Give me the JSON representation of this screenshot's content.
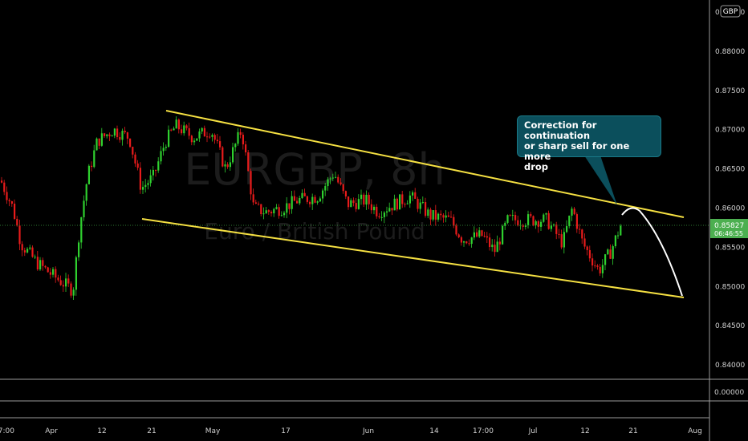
{
  "chart_data": {
    "type": "candlestick",
    "symbol_watermark": "EURGBP, 8h",
    "description_watermark": "Euro / British Pound",
    "currency_badge": "GBP",
    "x_tick_labels": [
      "17:00",
      "Apr",
      "12",
      "21",
      "May",
      "17",
      "Jun",
      "14",
      "17:00",
      "Jul",
      "12",
      "21",
      "Aug"
    ],
    "y_tick_labels": [
      "0.88500",
      "0.88000",
      "0.87500",
      "0.87000",
      "0.86500",
      "0.86000",
      "0.85500",
      "0.85000",
      "0.84500",
      "0.84000"
    ],
    "ylim": [
      0.837,
      0.8885
    ],
    "last_price": "0.85827",
    "countdown": "06:46:55",
    "indicator_tick_label": "0.00000",
    "trendlines": [
      {
        "name": "upper channel",
        "from": {
          "x": "Apr 21",
          "y": 0.8727
        },
        "to": {
          "x": "Jul 27",
          "y": 0.8589
        }
      },
      {
        "name": "lower channel",
        "from": {
          "x": "Apr 18",
          "y": 0.8588
        },
        "to": {
          "x": "Jul 28",
          "y": 0.849
        }
      }
    ],
    "projection": [
      [
        0.859,
        0.86,
        0.8595,
        0.8575,
        0.8545,
        0.851,
        0.849
      ]
    ],
    "annotation": [
      "Correction for continuation",
      "or sharp sell for one more",
      "drop"
    ],
    "colors": {
      "up": "#2fd02f",
      "down": "#e81b1b",
      "trendline": "#f5e042",
      "projection": "#ffffff",
      "last_price": "#4caf50",
      "annotation_bg": "#0b4f5c"
    }
  }
}
